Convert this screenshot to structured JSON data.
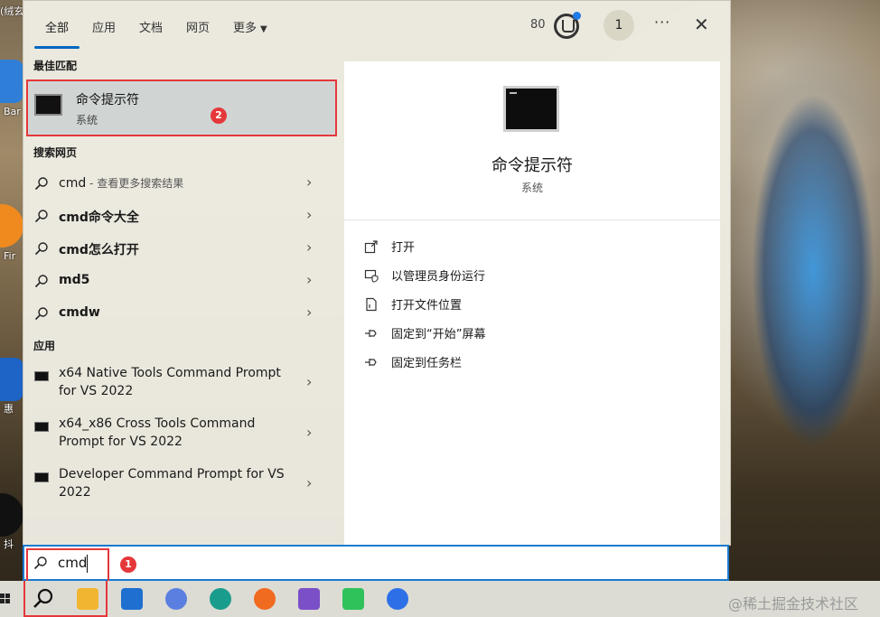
{
  "desktop": {
    "icons": [
      {
        "label": "Bar",
        "color": "#2f7fd8"
      },
      {
        "label": "Fir",
        "color": "#f08a1f"
      },
      {
        "label": "惠",
        "color": "#1e63c6"
      },
      {
        "label": "抖",
        "color": "#111111"
      }
    ],
    "top_left_text": "(绒玄"
  },
  "tabs": {
    "items": [
      "全部",
      "应用",
      "文档",
      "网页"
    ],
    "more_label": "更多",
    "active": "全部"
  },
  "header": {
    "score": "80",
    "avatar_text": "1",
    "more_icon": "ellipsis-icon",
    "close_icon": "close-icon"
  },
  "best_match": {
    "section": "最佳匹配",
    "title": "命令提示符",
    "subtitle": "系统",
    "badge": "2"
  },
  "web": {
    "section": "搜索网页",
    "rows": [
      {
        "bold": "cmd",
        "rest": "",
        "hint": " - 查看更多搜索结果"
      },
      {
        "bold": "cmd命令大全",
        "rest": "",
        "hint": ""
      },
      {
        "bold": "cmd怎么打开",
        "rest": "",
        "hint": ""
      },
      {
        "bold": "md5",
        "rest": "",
        "hint": ""
      },
      {
        "bold": "cmdw",
        "rest": "",
        "hint": ""
      }
    ]
  },
  "apps": {
    "section": "应用",
    "rows": [
      {
        "label": "x64 Native Tools Command Prompt for VS 2022"
      },
      {
        "label": "x64_x86 Cross Tools Command Prompt for VS 2022"
      },
      {
        "label": "Developer Command Prompt for VS 2022"
      }
    ]
  },
  "preview": {
    "title": "命令提示符",
    "subtitle": "系统",
    "actions": [
      {
        "label": "打开",
        "icon": "open-icon"
      },
      {
        "label": "以管理员身份运行",
        "icon": "shield-admin-icon"
      },
      {
        "label": "打开文件位置",
        "icon": "file-location-icon"
      },
      {
        "label": "固定到“开始”屏幕",
        "icon": "pin-icon"
      },
      {
        "label": "固定到任务栏",
        "icon": "pin-icon"
      }
    ]
  },
  "search": {
    "value": "cmd",
    "badge": "1"
  },
  "taskbar": {
    "apps": [
      {
        "name": "file-explorer",
        "color": "#f2b530"
      },
      {
        "name": "mail",
        "color": "#1f6fd1"
      },
      {
        "name": "photos",
        "color": "#5b7fe0"
      },
      {
        "name": "edge",
        "color": "#1a9c8c"
      },
      {
        "name": "firefox",
        "color": "#f06a1f"
      },
      {
        "name": "visual-studio",
        "color": "#7b4fc7"
      },
      {
        "name": "wechat-like",
        "color": "#2fc25b"
      },
      {
        "name": "app-blue",
        "color": "#2d6fe6"
      }
    ],
    "watermark": "@稀土掘金技术社区"
  },
  "colors": {
    "accent": "#0067c0",
    "highlight_red": "#e5373a"
  }
}
